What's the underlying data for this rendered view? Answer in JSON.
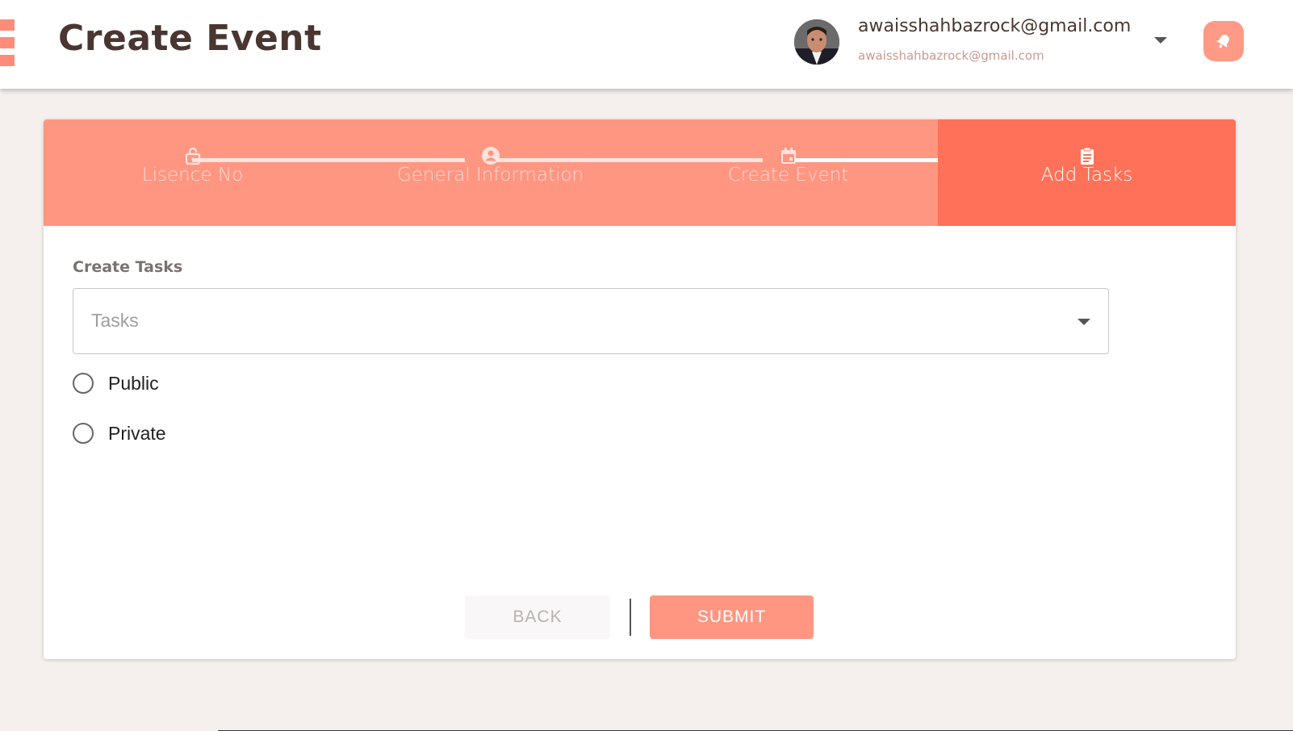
{
  "header": {
    "title": "Create Event",
    "user_email": "awaisshahbazrock@gmail.com",
    "user_sub": "awaisshahbazrock@gmail.com"
  },
  "stepper": {
    "steps": [
      {
        "label": "Lisence No",
        "icon": "lock-icon"
      },
      {
        "label": "General Information",
        "icon": "account-circle-icon"
      },
      {
        "label": "Create Event",
        "icon": "calendar-icon"
      },
      {
        "label": "Add Tasks",
        "icon": "clipboard-icon"
      }
    ],
    "active_step": 3
  },
  "form": {
    "label": "Create Tasks",
    "tasks_placeholder": "Tasks",
    "radio_options": [
      {
        "label": "Public",
        "selected": false
      },
      {
        "label": "Private",
        "selected": false
      }
    ]
  },
  "actions": {
    "back_label": "BACK",
    "submit_label": "SUBMIT"
  },
  "colors": {
    "accent": "#ff9682",
    "accent_active": "#ff7158",
    "title": "#4a3630"
  }
}
